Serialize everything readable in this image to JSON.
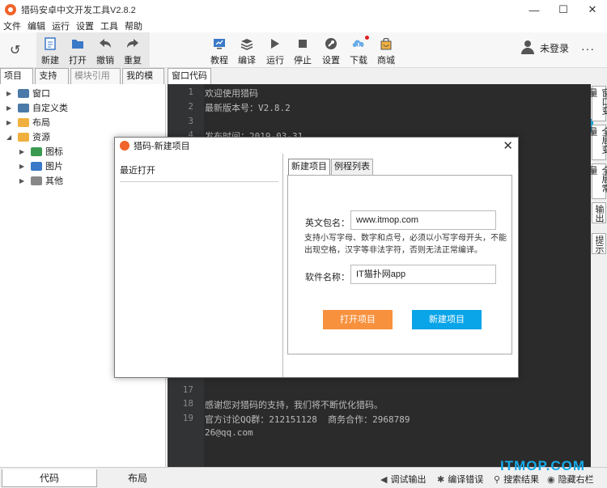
{
  "window": {
    "title": "猎码安卓中文开发工具V2.8.2",
    "controls": [
      "—",
      "☐",
      "✕"
    ]
  },
  "menu": [
    "文件",
    "编辑",
    "运行",
    "设置",
    "工具",
    "帮助"
  ],
  "toolbar": {
    "left": [
      {
        "label": "新建",
        "icon": "new-file-icon"
      },
      {
        "label": "打开",
        "icon": "folder-open-icon"
      },
      {
        "label": "撤销",
        "icon": "undo-icon"
      },
      {
        "label": "重复",
        "icon": "redo-icon"
      }
    ],
    "center": [
      {
        "label": "教程",
        "icon": "tutorial-icon"
      },
      {
        "label": "编译",
        "icon": "compile-icon"
      },
      {
        "label": "运行",
        "icon": "run-icon"
      },
      {
        "label": "停止",
        "icon": "stop-icon"
      },
      {
        "label": "设置",
        "icon": "settings-icon"
      },
      {
        "label": "下载",
        "icon": "download-icon"
      },
      {
        "label": "商城",
        "icon": "store-icon"
      }
    ],
    "user_label": "未登录",
    "more": "···",
    "history_icon": "↺"
  },
  "left_tabs": [
    "项目树",
    "支持库",
    "模块引用表",
    "我的模板"
  ],
  "tree": [
    {
      "label": "窗口",
      "level": 0,
      "expanded": false,
      "color": "#4a7aa8"
    },
    {
      "label": "自定义类",
      "level": 0,
      "expanded": false,
      "color": "#4a7aa8"
    },
    {
      "label": "布局",
      "level": 0,
      "expanded": false,
      "color": "#f0b040"
    },
    {
      "label": "资源",
      "level": 0,
      "expanded": true,
      "color": "#f0b040"
    },
    {
      "label": "图标",
      "level": 1,
      "expanded": false,
      "color": "#3a9a50"
    },
    {
      "label": "图片",
      "level": 1,
      "expanded": false,
      "color": "#3a78c8"
    },
    {
      "label": "其他",
      "level": 1,
      "expanded": false,
      "color": "#888888"
    }
  ],
  "editor": {
    "tab": "窗口代码",
    "lines": [
      {
        "n": "1",
        "text": "欢迎使用猎码"
      },
      {
        "n": "2",
        "text": "最新版本号：V2.8.2"
      },
      {
        "n": "3",
        "text": ""
      },
      {
        "n": "4",
        "text": "发布时间：2019-03-31"
      },
      {
        "n": "17",
        "text": ""
      },
      {
        "n": "18",
        "text": "感谢您对猎码的支持，我们将不断优化猎码。"
      },
      {
        "n": "19",
        "text": "官方讨论QQ群：212151128  商务合作：2968789"
      },
      {
        "n": "",
        "text": "26@qq.com"
      }
    ]
  },
  "right_tabs": [
    "窗口变量",
    "全局变量",
    "全局常量",
    "输出",
    "提示"
  ],
  "bottom": {
    "tabs": [
      "代码",
      "布局"
    ],
    "buttons": [
      {
        "label": "调试输出",
        "icon": "speaker-icon"
      },
      {
        "label": "编译错误",
        "icon": "bug-icon"
      },
      {
        "label": "搜索结果",
        "icon": "search-icon"
      },
      {
        "label": "隐藏右栏",
        "icon": "hide-eye-icon"
      }
    ],
    "watermark": "ITMOP.COM"
  },
  "dialog": {
    "title": "猎码-新建项目",
    "close": "✕",
    "recent_label": "最近打开",
    "tabs": [
      "新建项目",
      "例程列表"
    ],
    "package_label": "英文包名：",
    "package_value": "www.itmop.com",
    "hint": "支持小写字母、数字和点号，必须以小写字母开头，不能出现空格，汉字等非法字符，否则无法正常编译。",
    "name_label": "软件名称：",
    "name_value": "IT猫扑网app",
    "open_button": "打开项目",
    "new_button": "新建项目"
  }
}
